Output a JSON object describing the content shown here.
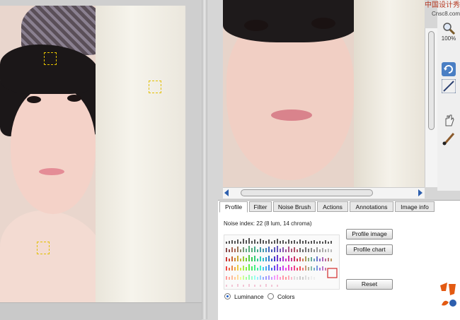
{
  "watermark": {
    "line1": "中国设计秀",
    "line2": "Cnsc8.com"
  },
  "zoom": {
    "level": "100%"
  },
  "tabs": [
    {
      "label": "Profile"
    },
    {
      "label": "Filter"
    },
    {
      "label": "Noise Brush"
    },
    {
      "label": "Actions"
    },
    {
      "label": "Annotations"
    },
    {
      "label": "Image info"
    }
  ],
  "profile": {
    "noise_index": "Noise index:  22 (8 lum, 14 chroma)",
    "buttons": {
      "profile_image": "Profile image",
      "profile_chart": "Profile chart",
      "reset": "Reset"
    },
    "radios": {
      "luminance": "Luminance",
      "colors": "Colors",
      "selected": "Luminance"
    }
  },
  "toolbar": {
    "icons": [
      "zoom-icon",
      "rotate-icon",
      "adjust-icon",
      "hand-icon",
      "brush-icon"
    ]
  },
  "colors": {
    "accent": "#2d5fae",
    "sample_box": "#e3c000",
    "watermark": "#b63a22"
  }
}
